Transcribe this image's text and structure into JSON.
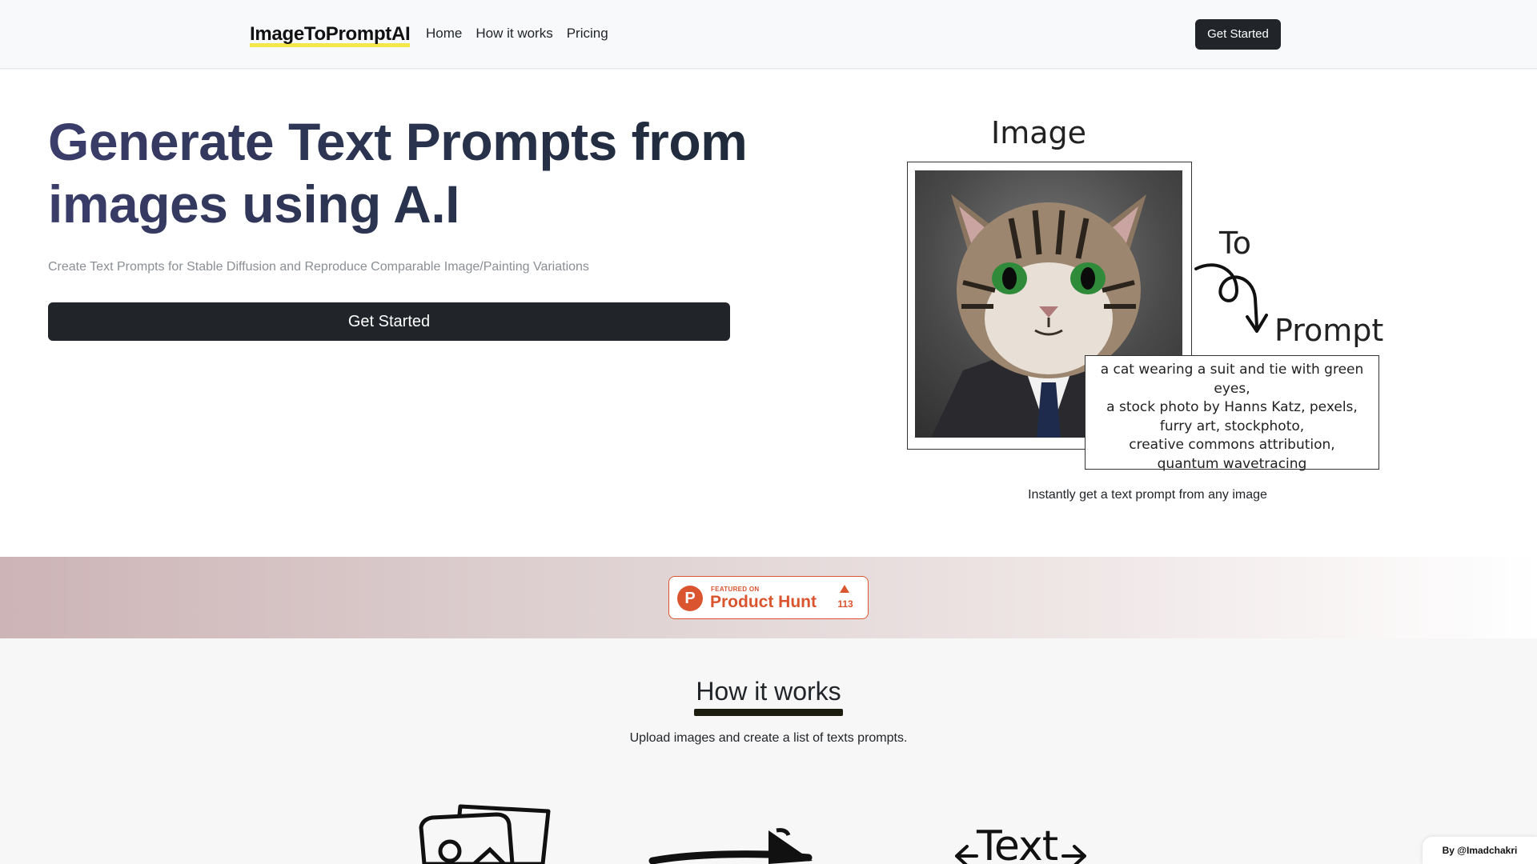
{
  "nav": {
    "brand": "ImageToPromptAI",
    "links": [
      "Home",
      "How it works",
      "Pricing"
    ],
    "cta": "Get Started"
  },
  "hero": {
    "title": "Generate Text Prompts from images using A.I",
    "subtitle": "Create Text Prompts for Stable Diffusion and Reproduce Comparable Image/Painting Variations",
    "cta": "Get Started"
  },
  "illustration": {
    "label_image": "Image",
    "label_to": "To",
    "label_prompt": "Prompt",
    "prompt_lines": [
      "a cat wearing a suit and tie with green eyes,",
      "a stock photo by Hanns Katz, pexels,",
      "furry art, stockphoto,",
      "creative commons attribution,",
      "quantum wavetracing"
    ],
    "caption": "Instantly get a text prompt from any image"
  },
  "product_hunt": {
    "logo_letter": "P",
    "featured": "FEATURED ON",
    "name": "Product Hunt",
    "count": "113"
  },
  "how_it_works": {
    "title": "How it works",
    "subtitle": "Upload images and create a list of texts prompts.",
    "step3_label": "Text"
  },
  "credit": "By @Imadchakri",
  "colors": {
    "dark": "#212529",
    "brand_highlight": "#f3e84a",
    "product_hunt": "#da552f"
  }
}
